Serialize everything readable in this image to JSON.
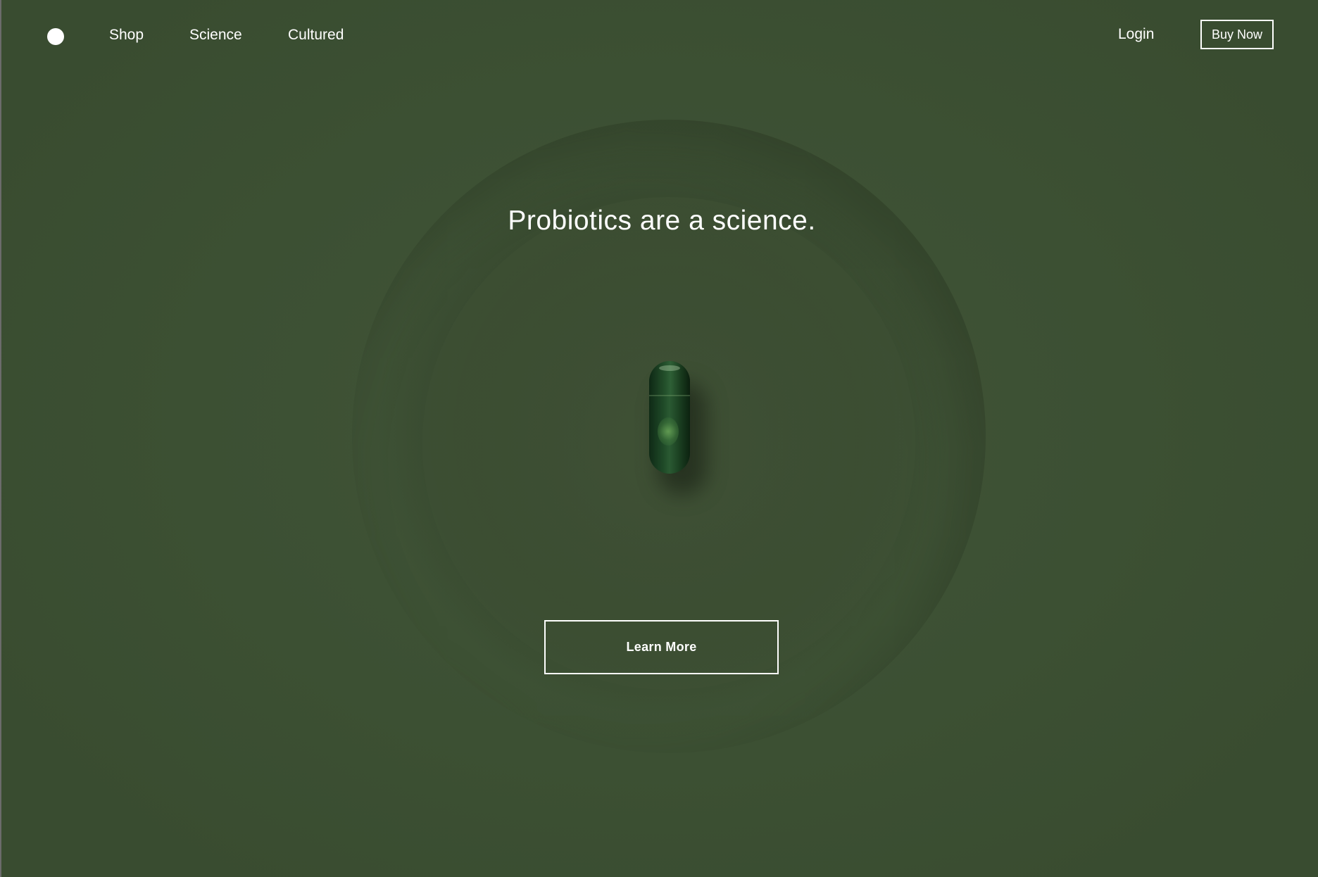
{
  "nav": {
    "links": [
      {
        "label": "Shop"
      },
      {
        "label": "Science"
      },
      {
        "label": "Cultured"
      }
    ],
    "login_label": "Login",
    "buy_now_label": "Buy Now"
  },
  "hero": {
    "headline": "Probiotics are a science.",
    "cta_label": "Learn More"
  },
  "colors": {
    "background": "#3f5236",
    "text": "#ffffff",
    "capsule": "#1f4a28"
  },
  "icons": {
    "logo": "logo-dot-icon",
    "product": "capsule-icon"
  }
}
